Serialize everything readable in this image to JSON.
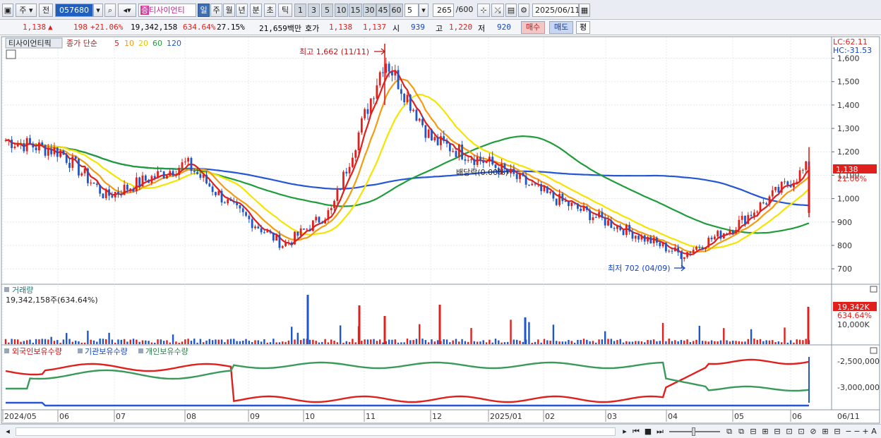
{
  "toolbar": {
    "market": "주",
    "prev": "전",
    "code": "057680",
    "stock_name": "티사이언티",
    "period_buttons": [
      "일",
      "주",
      "월",
      "년",
      "분",
      "초",
      "틱"
    ],
    "interval_buttons": [
      "1",
      "3",
      "5",
      "10",
      "15",
      "30",
      "45",
      "60"
    ],
    "interval_value": "5",
    "count": "265",
    "count_total": "/600",
    "date": "2025/06/11",
    "share_badge": "증"
  },
  "quote": {
    "price": "1,138",
    "arrow": "▲",
    "change": "198",
    "change_pct": "+21.06%",
    "volume": "19,342,158",
    "volume_pct": "634.64%",
    "turnover": "27.15%",
    "amount": "21,659백만",
    "hoga_label": "호가",
    "ask": "1,138",
    "bid": "1,137",
    "open_label": "시",
    "open": "939",
    "high_label": "고",
    "high": "1,220",
    "low_label": "저",
    "low": "920",
    "buy": "매수",
    "sell": "매도",
    "eval": "평"
  },
  "price_panel": {
    "title": "티사이언티픽",
    "ma_label": "종가 단순",
    "ma_periods": [
      "5",
      "10",
      "20",
      "60",
      "120"
    ],
    "ma_colors": [
      "#e0201c",
      "#f39c12",
      "#f5e400",
      "#1f9d3a",
      "#2456d6"
    ],
    "lc": "LC:62.11",
    "hc": "HC:-31.53",
    "high_annotation": "최고 1,662 (11/11)",
    "low_annotation": "최저 702 (04/09)",
    "dividend_annotation": "배당락(0.00%)",
    "current_price_tag": "1,138",
    "current_pct_tag": "21.06%"
  },
  "volume_panel": {
    "title": "거래량",
    "value": "19,342,158주(634.64%)",
    "tag_value": "19,342K",
    "tag_pct": "634.64%",
    "tick": "10,000K"
  },
  "holdings_panel": {
    "legend": [
      "외국인보유수량",
      "기관보유수량",
      "개인보유수량"
    ],
    "colors": [
      "#e0201c",
      "#2456d6",
      "#3a9a5a"
    ],
    "ticks": [
      "-2,500,000",
      "-3,000,000"
    ]
  },
  "x_axis_labels": [
    "2024/05",
    "06",
    "07",
    "08",
    "09",
    "10",
    "11",
    "12",
    "2025/01",
    "02",
    "03",
    "04",
    "05",
    "06",
    "06/11"
  ],
  "chart_data": {
    "type": "candlestick",
    "price_axis": {
      "ticks": [
        700,
        800,
        900,
        1000,
        1100,
        1200,
        1300,
        1400,
        1500,
        1600
      ],
      "min": 640,
      "max": 1680
    },
    "key_points": [
      {
        "date": "2024/05",
        "close": 1250
      },
      {
        "date": "2024/06",
        "close": 1200
      },
      {
        "date": "2024/07",
        "close": 1010
      },
      {
        "date": "2024/08",
        "close": 1150
      },
      {
        "date": "2024/09",
        "close": 960
      },
      {
        "date": "2024/10",
        "close": 800
      },
      {
        "date": "2024/11",
        "close": 950
      },
      {
        "date": "2024/11/11",
        "high": 1662
      },
      {
        "date": "2024/12",
        "close": 1250
      },
      {
        "date": "2025/01",
        "close": 1150
      },
      {
        "date": "2025/02",
        "close": 1020
      },
      {
        "date": "2025/03",
        "close": 900
      },
      {
        "date": "2025/04/09",
        "low": 702
      },
      {
        "date": "2025/05",
        "close": 880
      },
      {
        "date": "2025/06/11",
        "close": 1138,
        "high": 1220
      }
    ],
    "volume": {
      "last": 19342158,
      "last_pct": 634.64,
      "tick": "10,000K"
    }
  }
}
